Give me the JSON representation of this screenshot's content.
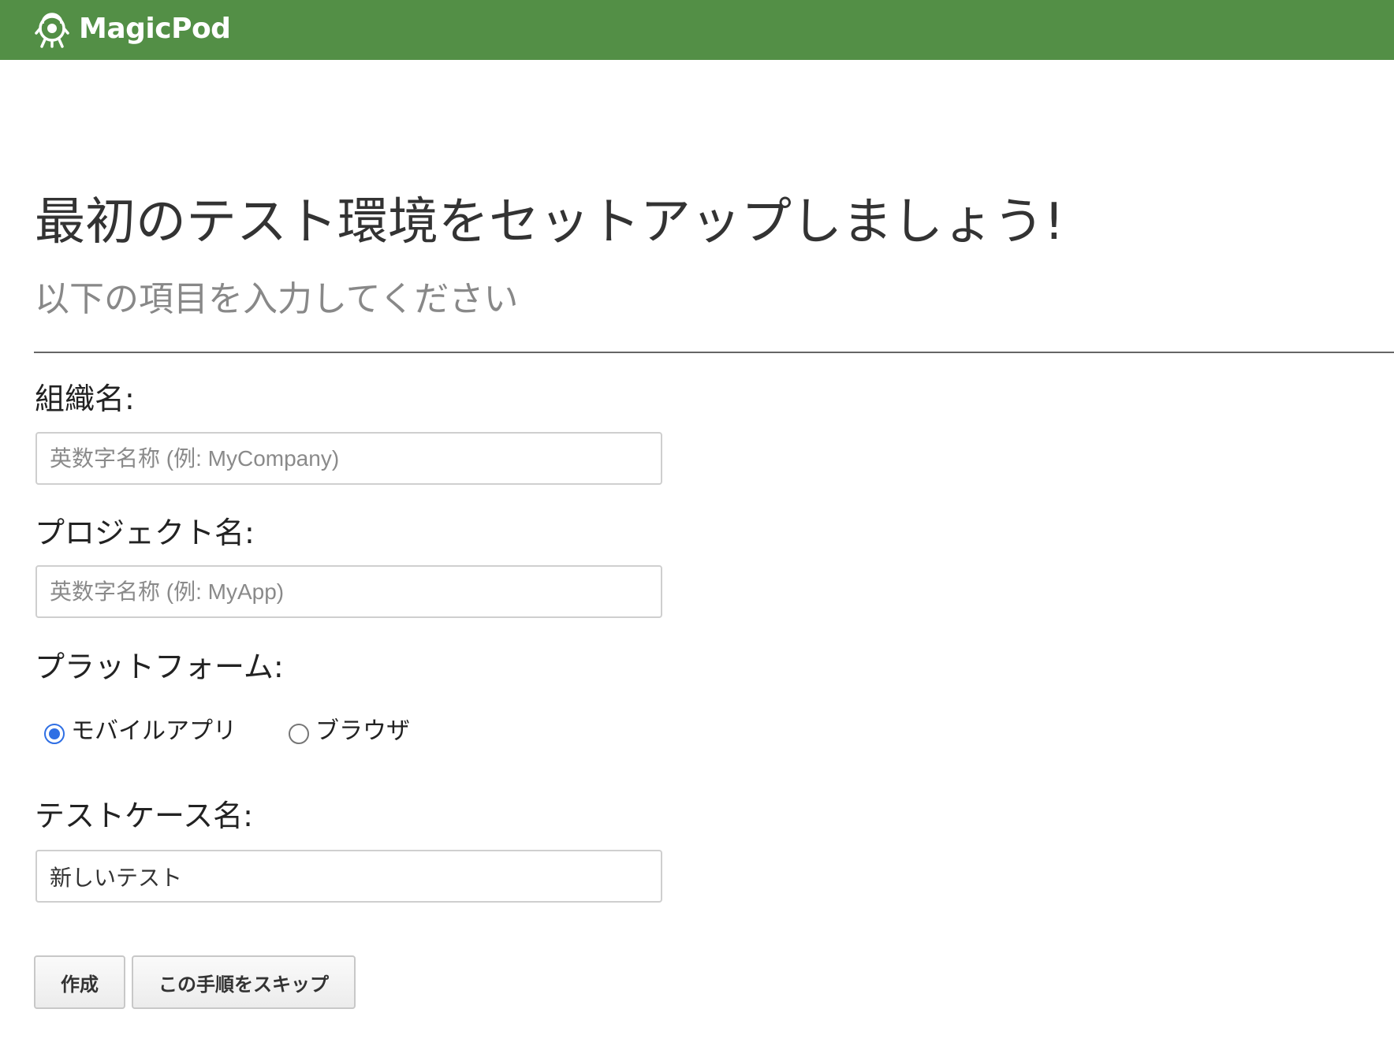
{
  "header": {
    "logo_text": "MagicPod",
    "background_color": "#538f46",
    "logo_icon": "robot-icon"
  },
  "main": {
    "title": "最初のテスト環境をセットアップしましょう!",
    "subtitle": "以下の項目を入力してください"
  },
  "form": {
    "organization": {
      "label": "組織名:",
      "value": "",
      "placeholder": "英数字名称 (例: MyCompany)"
    },
    "project": {
      "label": "プロジェクト名:",
      "value": "",
      "placeholder": "英数字名称 (例: MyApp)"
    },
    "platform": {
      "label": "プラットフォーム:",
      "options": [
        {
          "label": "モバイルアプリ",
          "selected": true
        },
        {
          "label": "ブラウザ",
          "selected": false
        }
      ]
    },
    "testcase": {
      "label": "テストケース名:",
      "value": "新しいテスト",
      "placeholder": ""
    },
    "buttons": {
      "create_label": "作成",
      "skip_label": "この手順をスキップ"
    }
  },
  "colors": {
    "accent_radio": "#2f6fe4",
    "header_green": "#538f46"
  }
}
